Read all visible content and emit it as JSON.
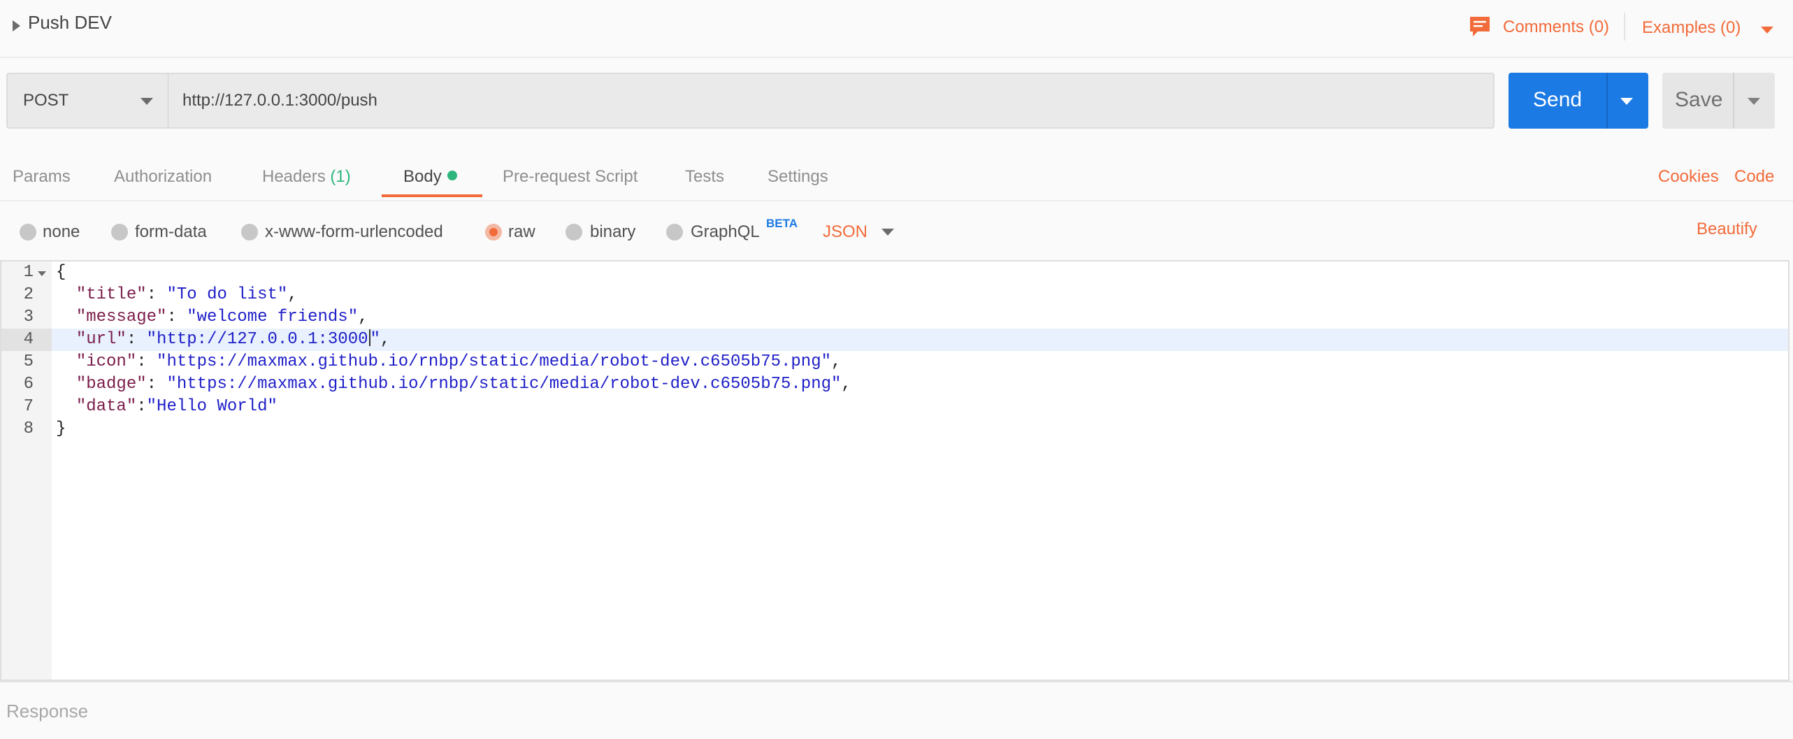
{
  "header": {
    "request_name": "Push DEV",
    "comments_label": "Comments (0)",
    "examples_label": "Examples (0)"
  },
  "url_bar": {
    "method": "POST",
    "url": "http://127.0.0.1:3000/push",
    "send_label": "Send",
    "save_label": "Save"
  },
  "tabs": [
    {
      "label": "Params"
    },
    {
      "label": "Authorization"
    },
    {
      "label": "Headers",
      "count": "(1)"
    },
    {
      "label": "Body",
      "active": true
    },
    {
      "label": "Pre-request Script"
    },
    {
      "label": "Tests"
    },
    {
      "label": "Settings"
    }
  ],
  "tab_links": {
    "cookies": "Cookies",
    "code": "Code"
  },
  "body_types": [
    {
      "label": "none"
    },
    {
      "label": "form-data"
    },
    {
      "label": "x-www-form-urlencoded"
    },
    {
      "label": "raw",
      "selected": true
    },
    {
      "label": "binary"
    },
    {
      "label": "GraphQL"
    }
  ],
  "graphql_badge": "BETA",
  "language": "JSON",
  "beautify_label": "Beautify",
  "editor": {
    "active_line": 4,
    "lines": [
      {
        "num": "1",
        "text": "{"
      },
      {
        "num": "2",
        "text": "  \"title\": \"To do list\","
      },
      {
        "num": "3",
        "text": "  \"message\": \"welcome friends\","
      },
      {
        "num": "4",
        "text": "  \"url\": \"http://127.0.0.1:3000\","
      },
      {
        "num": "5",
        "text": "  \"icon\": \"https://maxmax.github.io/rnbp/static/media/robot-dev.c6505b75.png\","
      },
      {
        "num": "6",
        "text": "  \"badge\": \"https://maxmax.github.io/rnbp/static/media/robot-dev.c6505b75.png\","
      },
      {
        "num": "7",
        "text": "  \"data\":\"Hello World\""
      },
      {
        "num": "8",
        "text": "}"
      }
    ]
  },
  "response_label": "Response",
  "colors": {
    "accent_orange": "#f26b3a",
    "send_blue": "#1b7ae4",
    "status_green": "#2eb67d"
  }
}
